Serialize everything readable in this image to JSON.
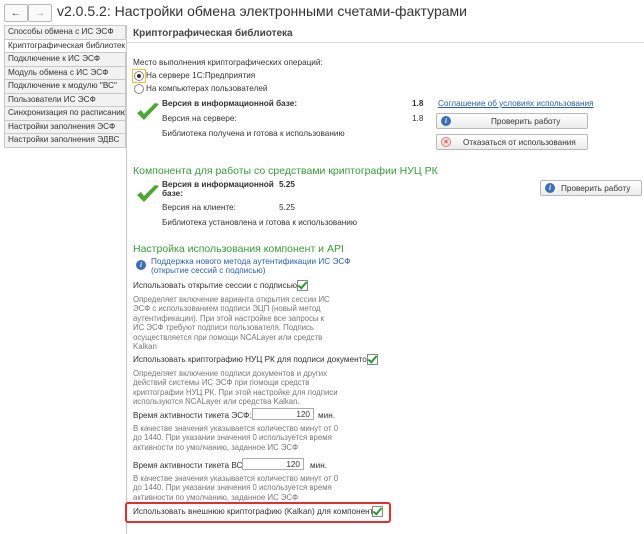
{
  "window": {
    "title": "v2.0.5.2: Настройки обмена электронными счетами-фактурами"
  },
  "sidebar": {
    "items": [
      {
        "label": "Способы обмена с ИС ЭСФ",
        "active": false
      },
      {
        "label": "Криптографическая библиотека",
        "active": true
      },
      {
        "label": "Подключение к ИС ЭСФ",
        "active": false
      },
      {
        "label": "Модуль обмена с ИС ЭСФ",
        "active": false
      },
      {
        "label": "Подключение к модулю \"ВС\"",
        "active": false
      },
      {
        "label": "Пользователи ИС ЭСФ",
        "active": false
      },
      {
        "label": "Синхронизация по расписанию",
        "active": false
      },
      {
        "label": "Настройки заполнения ЭСФ",
        "active": false
      },
      {
        "label": "Настройки заполнения ЭДВС",
        "active": false
      }
    ]
  },
  "main": {
    "header": "Криптографическая библиотека",
    "location_label": "Место выполнения криптографических операций:",
    "radio_server": "На сервере 1С:Предприятия",
    "radio_client": "На компьютерах пользователей",
    "version_db_label": "Версия в информационной базе:",
    "version_db_value": "1.8",
    "version_server_label": "Версия на сервере:",
    "version_server_value": "1.8",
    "library_status": "Библиотека получена и готова к использованию",
    "agreement_link": "Соглашение об условиях использования",
    "check_button": "Проверить работу",
    "refuse_button": "Отказаться от использования"
  },
  "nuc": {
    "section_title": "Компонента для работы со средствами криптографии НУЦ РК",
    "version_db_label": "Версия в информационной базе:",
    "version_db_value": "5.25",
    "version_client_label": "Версия на клиенте:",
    "version_client_value": "5.25",
    "library_status": "Библиотека установлена и готова к использованию",
    "check_button": "Проверить работу"
  },
  "api": {
    "section_title": "Настройка использования компонент и API",
    "info_text": "Поддержка нового метода аутентификации ИС ЭСФ\n(открытие сессий с подписью)",
    "use_sign_label": "Использовать открытие сессии с подписью:",
    "use_sign_checked": true,
    "use_sign_desc": "Определяет включение варианта открытия сессии ИС\nЭСФ с использованием подписи ЭЦП (новый метод\nаутентификации). При этой настройке все запросы к\nИС ЭСФ требуют подписи пользователя. Подпись\nосуществляется при помощи NCALayer или средств\nKalkan",
    "use_nuc_label": "Использовать криптографию НУЦ РК для подписи документов:",
    "use_nuc_checked": true,
    "use_nuc_desc": "Определяет включение подписи документов и других\nдействий системы ИС ЭСФ при помощи средств\nкриптографии НУЦ РК. При этой настройке для подписи\nиспользуются NCALayer или средства Kalkan.",
    "ticket_esf_label": "Время активности тикета ЭСФ:",
    "ticket_esf_value": "120",
    "ticket_esf_unit": "мин.",
    "ticket_esf_desc": "В качестве значения указывается количество минут от 0\nдо 1440. При указании значения 0 используется время\nактивности по умолчанию, заданное ИС ЭСФ",
    "ticket_vs_label": "Время активности тикета ВС:",
    "ticket_vs_value": "120",
    "ticket_vs_unit": "мин.",
    "ticket_vs_desc": "В качестве значения указывается количество минут от 0\nдо 1440. При указании значения 0 используется время\nактивности по умолчанию, заданное ИС ЭСФ",
    "use_kalkan_label": "Использовать внешнюю криптографию (Kalkan) для компоненты:",
    "use_kalkan_checked": true
  }
}
